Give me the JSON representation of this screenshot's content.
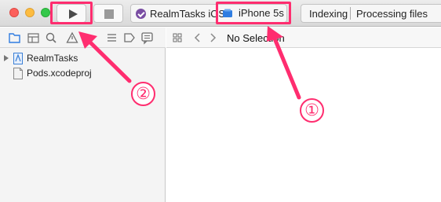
{
  "toolbar": {
    "window_controls": [
      "close",
      "minimize",
      "maximize"
    ],
    "run_icon": "play-icon",
    "stop_icon": "stop-icon",
    "scheme_label": "RealmTasks iOS",
    "scheme_separator": "›",
    "device_label": "iPhone 5s",
    "activity_status": "Indexing",
    "activity_detail": "Processing files"
  },
  "navigator": {
    "tabs": [
      "folder-icon",
      "hierarchy-icon",
      "search-icon",
      "warning-icon",
      "list-icon",
      "tag-icon",
      "comment-icon"
    ],
    "items": [
      {
        "label": "RealmTasks",
        "icon": "project-file-icon",
        "expandable": true
      },
      {
        "label": "Pods.xcodeproj",
        "icon": "document-icon",
        "expandable": false
      }
    ]
  },
  "editor": {
    "jump_label": "No Selection"
  },
  "annotations": {
    "badge_1": "①",
    "badge_2": "②",
    "color": "#ff2d6f"
  },
  "colors": {
    "highlight": "#ff2d6f",
    "accent": "#2f7de1",
    "toolbar_bg": "#e4e4e4"
  }
}
